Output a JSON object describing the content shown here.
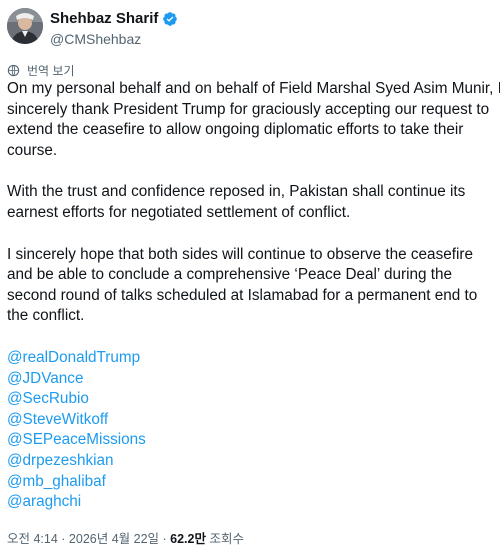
{
  "author": {
    "name": "Shehbaz Sharif",
    "handle": "@CMShehbaz"
  },
  "translate_label": "번역 보기",
  "paragraphs": [
    "On my personal behalf and on behalf of Field Marshal Syed Asim Munir, I\nsincerely thank President Trump for graciously accepting our request to\nextend the ceasefire to allow ongoing diplomatic efforts to take their\ncourse.",
    "With the trust and confidence reposed in, Pakistan shall continue its\nearnest efforts for negotiated settlement of conflict.",
    "I sincerely hope that both sides will continue to observe the ceasefire\nand be able to conclude a comprehensive ‘Peace Deal’ during the\nsecond round of talks scheduled at Islamabad for a permanent end to\nthe conflict."
  ],
  "mentions": [
    "@realDonaldTrump",
    "@JDVance",
    "@SecRubio",
    "@SteveWitkoff",
    "@SEPeaceMissions",
    "@drpezeshkian",
    "@mb_ghalibaf",
    "@araghchi"
  ],
  "meta": {
    "time": "오전 4:14",
    "separator": " · ",
    "date": "2026년 4월 22일",
    "views_count": "62.2만",
    "views_label": "조회수"
  },
  "colors": {
    "text": "#0f1419",
    "secondary": "#536471",
    "link": "#1d9bf0",
    "verified_badge": "#1d9bf0"
  }
}
